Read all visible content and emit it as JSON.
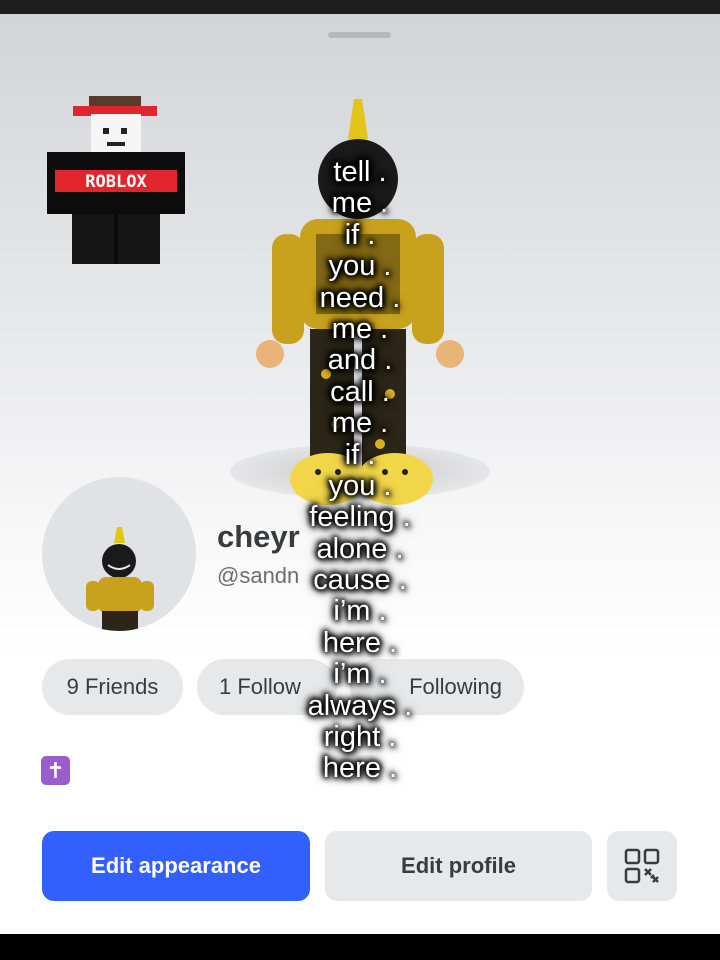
{
  "profile": {
    "display_name": "cheyr",
    "username": "@sandn"
  },
  "stats": {
    "friends": "9 Friends",
    "followers": "1 Follow",
    "following": "Following"
  },
  "actions": {
    "edit_appearance": "Edit appearance",
    "edit_profile": "Edit profile"
  },
  "badge": {
    "glyph": "✝",
    "color": "#9b5ccd"
  },
  "classic_avatar": {
    "shirt_text": "ROBLOX"
  },
  "colors": {
    "primary": "#335fff",
    "pill": "#e7e8ea",
    "text": "#393b3d"
  },
  "overlay_lyrics": [
    "tell .",
    "me .",
    "if .",
    "you .",
    "need .",
    "me .",
    "and .",
    "call .",
    "me .",
    "if .",
    "you .",
    "feeling .",
    "alone .",
    "cause .",
    "i’m .",
    "here .",
    "i’m .",
    "always .",
    "right .",
    "here ."
  ]
}
